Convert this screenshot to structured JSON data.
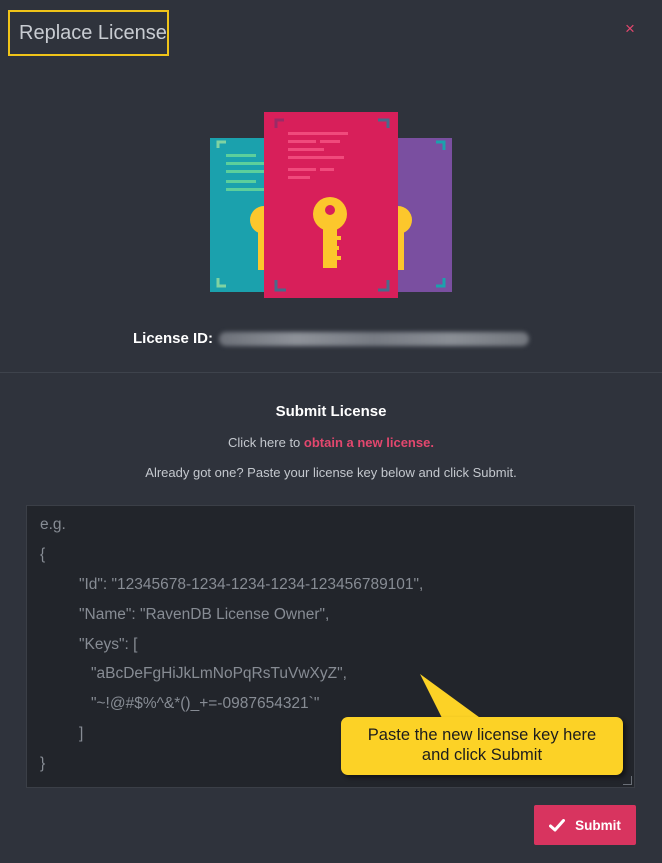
{
  "dialog": {
    "title": "Replace License",
    "close_glyph": "×"
  },
  "license": {
    "id_label": "License ID:"
  },
  "submit_section": {
    "title": "Submit License",
    "click_here_prefix": "Click here to ",
    "obtain_link": "obtain a new license.",
    "already_text": "Already got one? Paste your license key below and click Submit."
  },
  "textarea": {
    "placeholder_lines": [
      "e.g.",
      "{",
      "\"Id\": \"12345678-1234-1234-1234-123456789101\",",
      "\"Name\": \"RavenDB License Owner\",",
      "\"Keys\": [",
      "\"aBcDeFgHiJkLmNoPqRsTuVwXyZ\",",
      "\"~!@#$%^&*()_+=-0987654321`\"",
      "]",
      "}"
    ]
  },
  "callout": {
    "line1": "Paste the new license key here",
    "line2": "and click Submit"
  },
  "submit_button": {
    "label": "Submit",
    "icon": "checkmark-icon"
  },
  "colors": {
    "background": "#2f333c",
    "accent_pink": "#d8345f",
    "highlight_yellow": "#f0c419",
    "doc_teal": "#1ba1ad",
    "doc_purple": "#7a4fa0",
    "doc_pink": "#d81f5a",
    "key_yellow": "#fcc72c"
  }
}
